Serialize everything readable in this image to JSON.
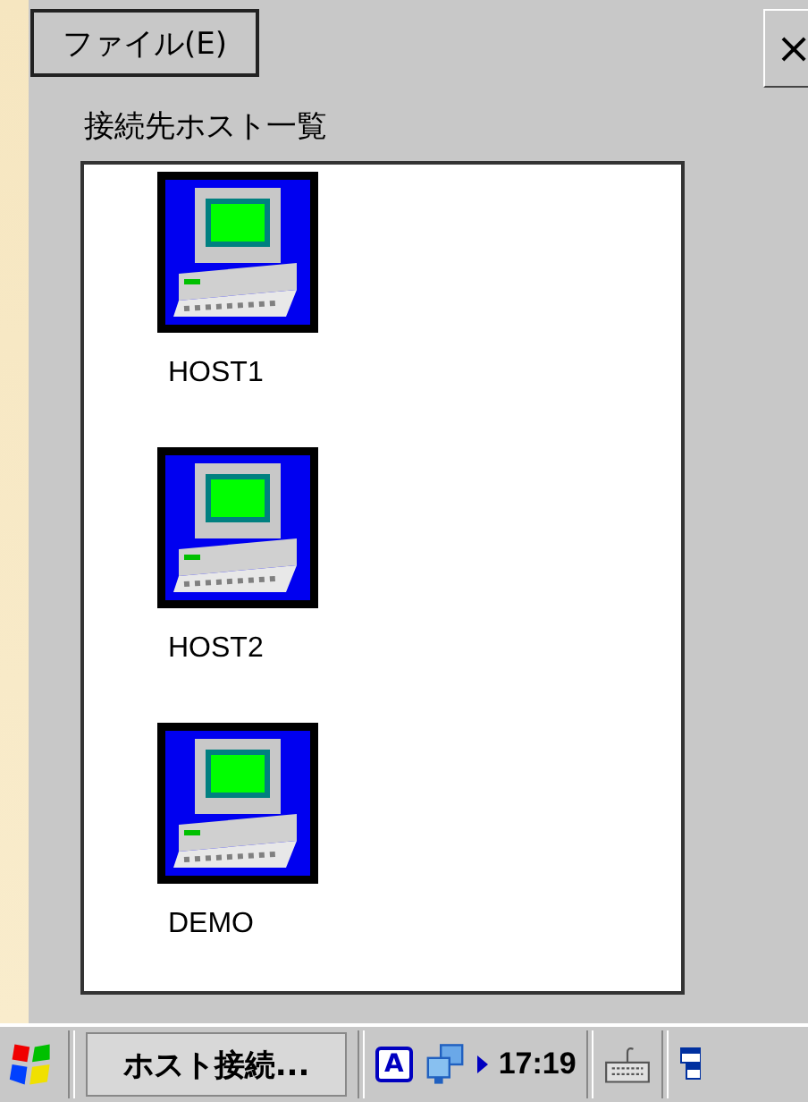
{
  "menu": [
    {
      "label": "ファイル(E)"
    }
  ],
  "close_button": "×",
  "list_label": "接続先ホスト一覧",
  "hosts": [
    {
      "name": "HOST1",
      "selected": false
    },
    {
      "name": "HOST2",
      "selected": false
    },
    {
      "name": "DEMO",
      "selected": false
    }
  ],
  "taskbar": {
    "task": "ホスト接続...",
    "input_mode": "A",
    "clock": "17:19"
  }
}
